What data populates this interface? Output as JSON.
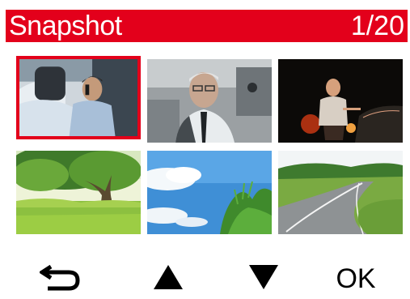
{
  "header": {
    "title": "Snapshot",
    "counter": "1/20",
    "background_color": "#e3001b"
  },
  "thumbnails": [
    {
      "subject": "man on phone in car",
      "selected": true
    },
    {
      "subject": "older man in car backseat",
      "selected": false
    },
    {
      "subject": "man at car at night",
      "selected": false
    },
    {
      "subject": "tree in green field",
      "selected": false
    },
    {
      "subject": "blue sky with clouds and plant",
      "selected": false
    },
    {
      "subject": "country road",
      "selected": false
    }
  ],
  "footer": {
    "back_icon": "return-arrow-icon",
    "up_icon": "triangle-up-icon",
    "down_icon": "triangle-down-icon",
    "ok_label": "OK"
  },
  "accent_color": "#e3001b"
}
